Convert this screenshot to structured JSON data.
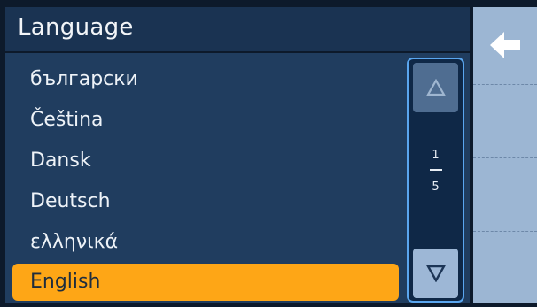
{
  "header": {
    "title": "Language"
  },
  "languages": [
    {
      "label": "български",
      "selected": false
    },
    {
      "label": "Čeština",
      "selected": false
    },
    {
      "label": "Dansk",
      "selected": false
    },
    {
      "label": "Deutsch",
      "selected": false
    },
    {
      "label": "ελληνικά",
      "selected": false
    },
    {
      "label": "English",
      "selected": true
    }
  ],
  "scroll": {
    "current_page": "1",
    "total_pages": "5"
  },
  "icons": {
    "back": "arrow-left-icon",
    "up": "triangle-up-icon",
    "down": "triangle-down-icon"
  },
  "colors": {
    "accent": "#fea616",
    "list_background": "#203d5f",
    "title_background": "#1a3352",
    "scrollbar_border": "#5aa6ef",
    "side_panel": "#9cb6d3"
  }
}
